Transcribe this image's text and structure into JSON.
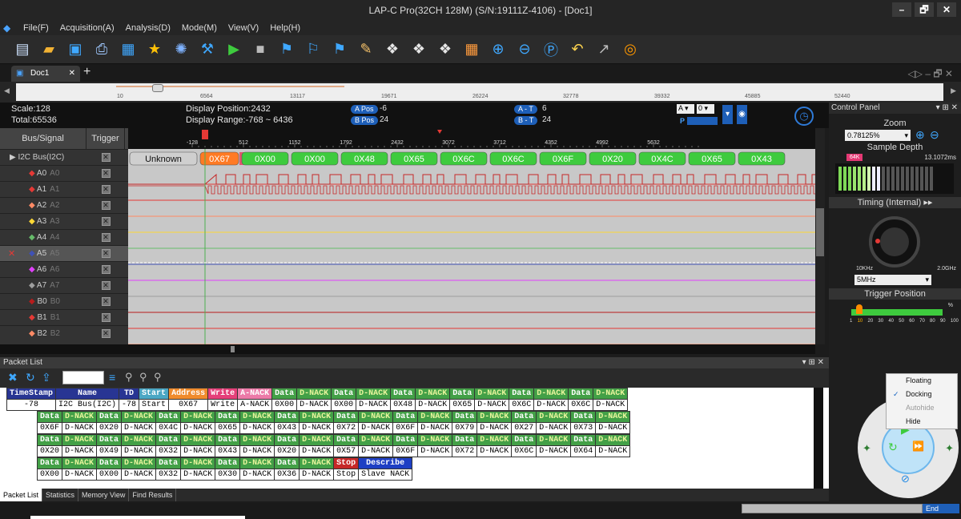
{
  "window": {
    "title": "LAP-C Pro(32CH 128M) (S/N:19111Z-4106) - [Doc1]",
    "controls": [
      "–",
      "🗗",
      "✕"
    ]
  },
  "menu": [
    "File(F)",
    "Acquisition(A)",
    "Analysis(D)",
    "Mode(M)",
    "View(V)",
    "Help(H)"
  ],
  "tab": {
    "name": "Doc1",
    "close": "✕",
    "add": "+"
  },
  "ruler_ticks": [
    "10",
    "6564",
    "13117",
    "19671",
    "26224",
    "32778",
    "39332",
    "45885",
    "52440"
  ],
  "info": {
    "scale": "Scale:128",
    "total": "Total:65536",
    "display_pos": "Display Position:2432",
    "display_range": "Display Range:-768 ~ 6436",
    "apos_label": "A Pos",
    "apos": "-6",
    "bpos_label": "B Pos",
    "bpos": "24",
    "at_label": "A - T",
    "at": "6",
    "bt_label": "B - T",
    "bt": "24",
    "sel_a": "A",
    "sel_b": "0",
    "sel_p": "P"
  },
  "wave_ticks": [
    "-128",
    "512",
    "1152",
    "1792",
    "2432",
    "3072",
    "3712",
    "4352",
    "4992",
    "5632"
  ],
  "signals": {
    "col_name": "Bus/Signal",
    "col_trigger": "Trigger",
    "rows": [
      {
        "label": "I2C Bus(I2C)",
        "color": "#ffffff"
      },
      {
        "label": "A0",
        "sub": "A0",
        "color": "#e53935"
      },
      {
        "label": "A1",
        "sub": "A1",
        "color": "#e53935"
      },
      {
        "label": "A2",
        "sub": "A2",
        "color": "#ff8a65"
      },
      {
        "label": "A3",
        "sub": "A3",
        "color": "#fdd835"
      },
      {
        "label": "A4",
        "sub": "A4",
        "color": "#66bb6a"
      },
      {
        "label": "A5",
        "sub": "A5",
        "color": "#3f51b5"
      },
      {
        "label": "A6",
        "sub": "A6",
        "color": "#e040fb"
      },
      {
        "label": "A7",
        "sub": "A7",
        "color": "#9e9e9e"
      },
      {
        "label": "B0",
        "sub": "B0",
        "color": "#b71c1c"
      },
      {
        "label": "B1",
        "sub": "B1",
        "color": "#e53935"
      },
      {
        "label": "B2",
        "sub": "B2",
        "color": "#ff8a65"
      }
    ]
  },
  "decode": [
    "Unknown",
    "0X67",
    "0X00",
    "0X00",
    "0X48",
    "0X65",
    "0X6C",
    "0X6C",
    "0X6F",
    "0X20",
    "0X4C",
    "0X65",
    "0X43"
  ],
  "control_panel": {
    "title": "Control Panel",
    "zoom_label": "Zoom",
    "zoom_value": "0.78125%",
    "depth_label": "Sample Depth",
    "depth_badge": "64K",
    "depth_time": "13.1072ms",
    "timing_label": "Timing (Internal)",
    "freq_min": "10KHz",
    "freq_max": "2.0GHz",
    "freq_value": "5MHz",
    "trig_label": "Trigger Position",
    "trig_pct": "%",
    "trig_ticks": [
      "1",
      "10",
      "20",
      "30",
      "40",
      "50",
      "60",
      "70",
      "80",
      "90",
      "100"
    ]
  },
  "packet": {
    "title": "Packet List",
    "header_row": [
      [
        "TimeStamp",
        "hblue"
      ],
      [
        "Name",
        "hblue"
      ],
      [
        "TD",
        "hblue"
      ],
      [
        "Start",
        "hstart"
      ],
      [
        "Address",
        "haddr"
      ],
      [
        "Write",
        "hwrite"
      ],
      [
        "A-NACK",
        "hanack"
      ],
      [
        "Data",
        "hdata"
      ],
      [
        "D-NACK",
        "hnack"
      ],
      [
        "Data",
        "hdata"
      ],
      [
        "D-NACK",
        "hnack"
      ],
      [
        "Data",
        "hdata"
      ],
      [
        "D-NACK",
        "hnack"
      ],
      [
        "Data",
        "hdata"
      ],
      [
        "D-NACK",
        "hnack"
      ],
      [
        "Data",
        "hdata"
      ],
      [
        "D-NACK",
        "hnack"
      ],
      [
        "Data",
        "hdata"
      ],
      [
        "D-NACK",
        "hnack"
      ]
    ],
    "first_row": [
      "-78",
      "I2C Bus(I2C)",
      "-78",
      "Start",
      "0X67",
      "Write",
      "A-NACK",
      "0X00",
      "D-NACK",
      "0X00",
      "D-NACK",
      "0X48",
      "D-NACK",
      "0X65",
      "D-NACK",
      "0X6C",
      "D-NACK",
      "0X6C",
      "D-NACK"
    ],
    "rows": [
      {
        "vals": [
          "0X6F",
          "D-NACK",
          "0X20",
          "D-NACK",
          "0X4C",
          "D-NACK",
          "0X65",
          "D-NACK",
          "0X43",
          "D-NACK",
          "0X72",
          "D-NACK",
          "0X6F",
          "D-NACK",
          "0X79",
          "D-NACK",
          "0X27",
          "D-NACK",
          "0X73",
          "D-NACK"
        ]
      },
      {
        "vals": [
          "0X20",
          "D-NACK",
          "0X49",
          "D-NACK",
          "0X32",
          "D-NACK",
          "0X43",
          "D-NACK",
          "0X20",
          "D-NACK",
          "0X57",
          "D-NACK",
          "0X6F",
          "D-NACK",
          "0X72",
          "D-NACK",
          "0X6C",
          "D-NACK",
          "0X64",
          "D-NACK"
        ]
      },
      {
        "vals": [
          "0X00",
          "D-NACK",
          "0X00",
          "D-NACK",
          "0X32",
          "D-NACK",
          "0X30",
          "D-NACK",
          "0X36",
          "D-NACK",
          "Stop",
          "Slave NACK"
        ],
        "last": true
      }
    ],
    "data_label": "Data",
    "nack_label": "D-NACK",
    "stop_label": "Stop",
    "describe_label": "Describe"
  },
  "bottom_tabs": [
    "Packet List",
    "Statistics",
    "Memory View",
    "Find Results"
  ],
  "context_menu": [
    "Floating",
    "Docking",
    "Autohide",
    "Hide"
  ],
  "status": {
    "end": "End"
  }
}
